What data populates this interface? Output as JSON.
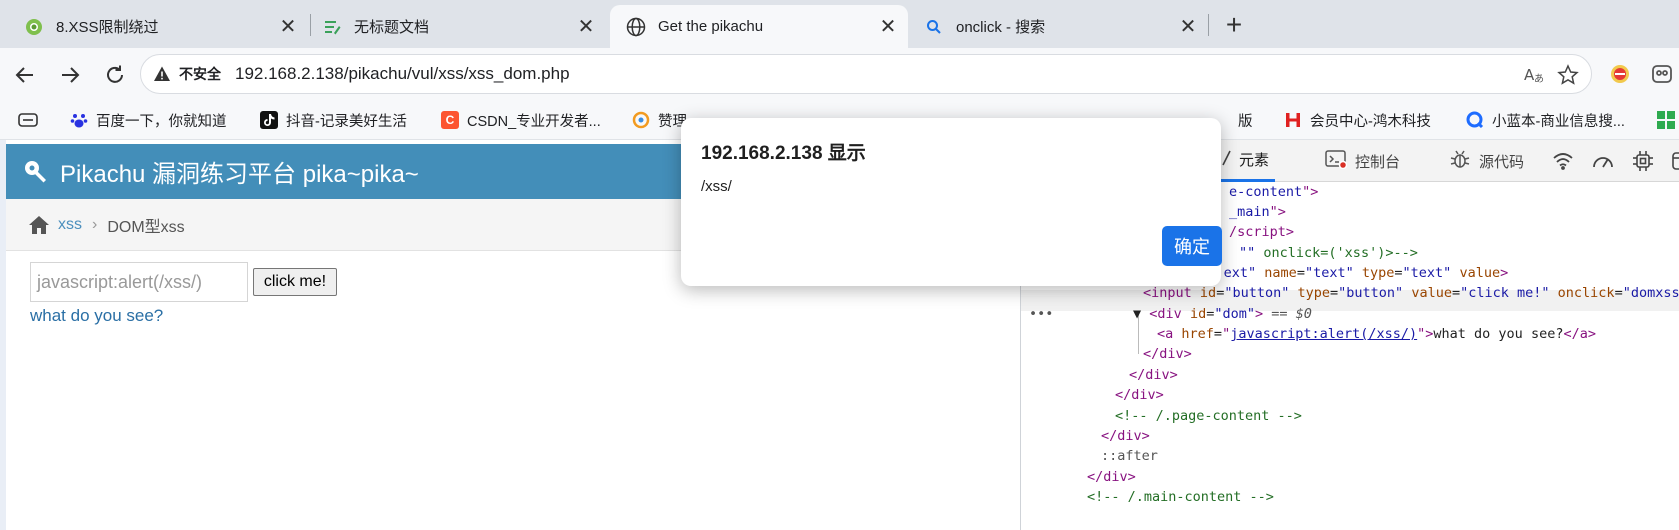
{
  "browser": {
    "tabs": [
      {
        "label": "8.XSS限制绕过",
        "icon": "pikachu-favicon-icon"
      },
      {
        "label": "无标题文档",
        "icon": "document-edit-icon"
      },
      {
        "label": "Get the pikachu",
        "icon": "globe-icon"
      },
      {
        "label": "onclick - 搜索",
        "icon": "search-icon"
      }
    ],
    "close_glyph": "✕",
    "new_tab_glyph": "+",
    "address": {
      "security_label": "不安全",
      "url": "192.168.2.138/pikachu/vul/xss/xss_dom.php"
    },
    "bookmarks": [
      {
        "label": "百度一下，你就知道",
        "icon": "baidu-paw-icon",
        "color": "#2932e1"
      },
      {
        "label": "抖音-记录美好生活",
        "icon": "douyin-icon",
        "color": "#111111"
      },
      {
        "label": "CSDN_专业开发者...",
        "icon": "csdn-icon",
        "color": "#fc5531"
      },
      {
        "label": "赞理",
        "icon": "bookmark-icon",
        "color": "#f29b20"
      },
      {
        "label": "版",
        "icon": "",
        "color": ""
      },
      {
        "label": "会员中心-鸿木科技",
        "icon": "hongmu-icon",
        "color": "#e02020"
      },
      {
        "label": "小蓝本-商业信息搜...",
        "icon": "xiaolanben-icon",
        "color": "#1e6cff"
      }
    ]
  },
  "page": {
    "banner_title": "Pikachu 漏洞练习平台 pika~pika~",
    "breadcrumb": {
      "link": "xss",
      "separator": "›",
      "current": "DOM型xss"
    },
    "input_placeholder": "javascript:alert(/xss/)",
    "button_label": "click me!",
    "result_link": "what do you see?"
  },
  "devtools": {
    "tabs": [
      {
        "label": "元素",
        "icon": "elements-icon"
      },
      {
        "label": "控制台",
        "icon": "console-icon"
      },
      {
        "label": "源代码",
        "icon": "sources-bug-icon"
      }
    ]
  },
  "dialog": {
    "title": "192.168.2.138 显示",
    "message": "/xss/",
    "ok_label": "确定"
  },
  "colors": {
    "banner": "#438eb9",
    "link": "#4c8fbd",
    "dialog_button": "#1a73e8"
  }
}
